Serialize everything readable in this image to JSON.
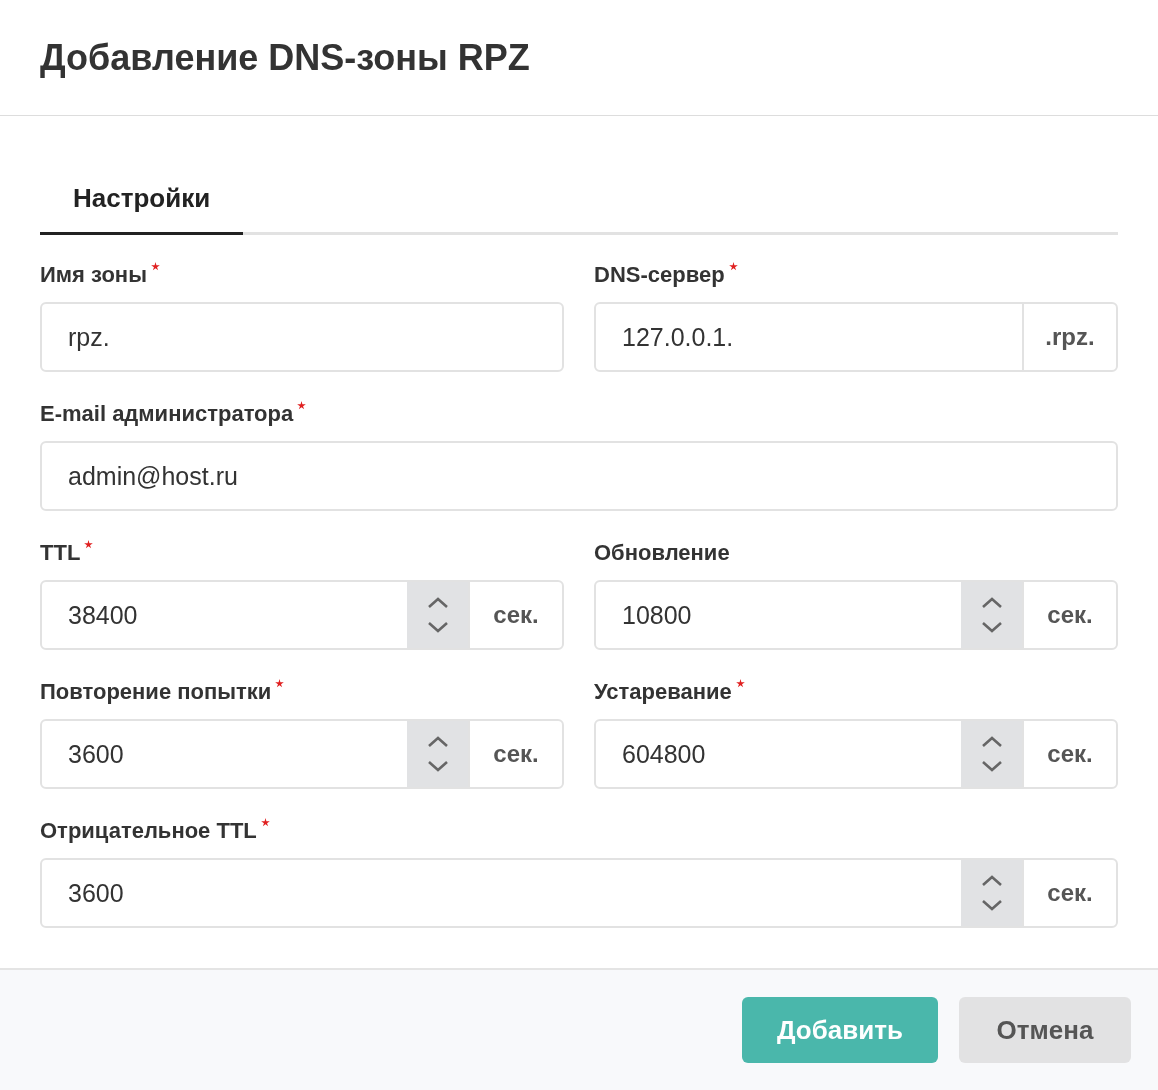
{
  "dialog": {
    "title": "Добавление DNS-зоны RPZ"
  },
  "tabs": [
    {
      "label": "Настройки",
      "selected": true
    }
  ],
  "rows": [
    [
      {
        "kind": "text",
        "label": "Имя зоны",
        "required": true,
        "value": "rpz."
      },
      {
        "kind": "suffix",
        "label": "DNS-сервер",
        "required": true,
        "value": "127.0.0.1.",
        "suffix": ".rpz."
      }
    ],
    [
      {
        "kind": "text",
        "label": "E-mail администратора",
        "required": true,
        "value": "admin@host.ru"
      }
    ],
    [
      {
        "kind": "number",
        "label": "TTL",
        "required": true,
        "value": "38400",
        "suffix": "сек."
      },
      {
        "kind": "number",
        "label": "Обновление",
        "required": false,
        "value": "10800",
        "suffix": "сек."
      }
    ],
    [
      {
        "kind": "number",
        "label": "Повторение попытки",
        "required": true,
        "value": "3600",
        "suffix": "сек."
      },
      {
        "kind": "number",
        "label": "Устаревание",
        "required": true,
        "value": "604800",
        "suffix": "сек."
      }
    ],
    [
      {
        "kind": "number",
        "label": "Отрицательное TTL",
        "required": true,
        "value": "3600",
        "suffix": "сек."
      }
    ]
  ],
  "buttons": [
    {
      "kind": "primary",
      "label": "Добавить"
    },
    {
      "kind": "secondary",
      "label": "Отмена"
    }
  ]
}
